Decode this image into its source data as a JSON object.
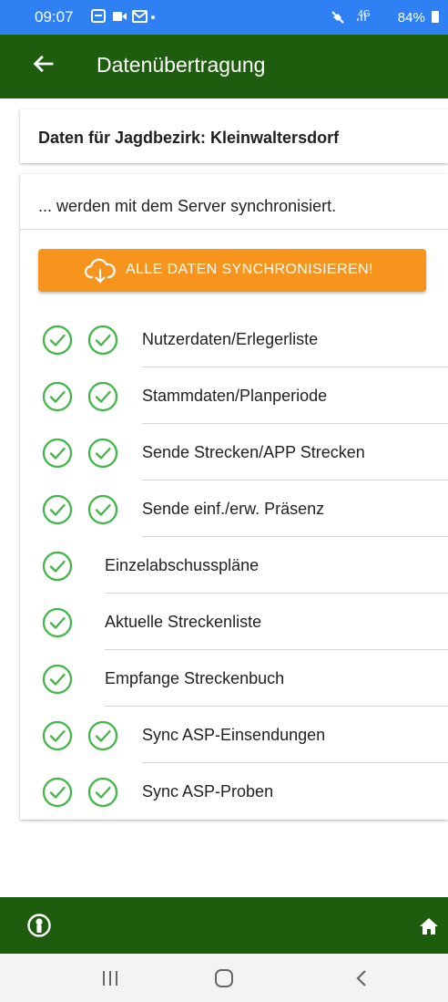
{
  "status_bar": {
    "time": "09:07",
    "network": "4G",
    "battery": "84%"
  },
  "app_bar": {
    "title": "Datenübertragung"
  },
  "header_card": {
    "title": "Daten für Jagdbezirk: Kleinwaltersdorf"
  },
  "sync_card": {
    "subtitle": "... werden mit dem Server synchronisiert.",
    "sync_button_label": "ALLE DATEN SYNCHRONISIEREN!",
    "items": [
      {
        "label": "Nutzerdaten/Erlegerliste",
        "checks": 2
      },
      {
        "label": "Stammdaten/Planperiode",
        "checks": 2
      },
      {
        "label": "Sende Strecken/APP Strecken",
        "checks": 2
      },
      {
        "label": "Sende einf./erw. Präsenz",
        "checks": 2
      },
      {
        "label": "Einzelabschusspläne",
        "checks": 1
      },
      {
        "label": "Aktuelle Streckenliste",
        "checks": 1
      },
      {
        "label": "Empfange Streckenbuch",
        "checks": 1
      },
      {
        "label": "Sync ASP-Einsendungen",
        "checks": 2
      },
      {
        "label": "Sync ASP-Proben",
        "checks": 2
      }
    ]
  },
  "icons": {
    "back": "arrow-back-icon",
    "cloud": "cloud-download-icon",
    "check": "check-circle-icon",
    "user": "user-icon",
    "home": "home-icon"
  },
  "colors": {
    "status_bar": "#2f80f2",
    "app_bar": "#1e5c0e",
    "accent_orange": "#f7941d",
    "check_green": "#43b649"
  }
}
